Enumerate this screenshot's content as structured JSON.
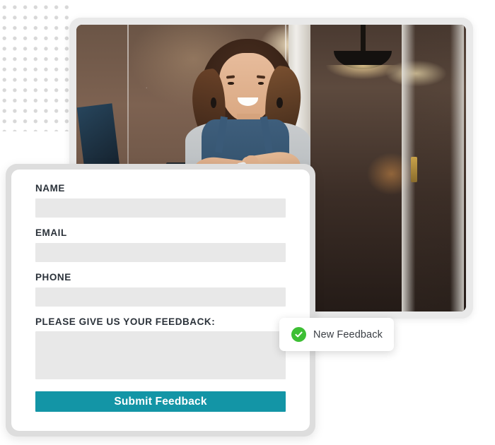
{
  "decor": {
    "dot_grid_name": "dot-grid-pattern",
    "dot_color": "#d8d8d8"
  },
  "photo_card": {
    "alt": "Smiling small business owner in a blue denim apron standing with arms crossed in her shop doorway",
    "frame_color": "#e9e9e9"
  },
  "form": {
    "fields": [
      {
        "label": "NAME",
        "value": "",
        "placeholder": "",
        "type": "text",
        "name": "name"
      },
      {
        "label": "EMAIL",
        "value": "",
        "placeholder": "",
        "type": "text",
        "name": "email"
      },
      {
        "label": "PHONE",
        "value": "",
        "placeholder": "",
        "type": "text",
        "name": "phone"
      }
    ],
    "feedback": {
      "label": "PLEASE GIVE US YOUR FEEDBACK:",
      "value": "",
      "placeholder": ""
    },
    "submit_label": "Submit Feedback",
    "accent_color": "#1395a6",
    "label_color": "#2b323a",
    "input_bg": "#e8e8e8"
  },
  "toast": {
    "icon": "check-circle-icon",
    "text": "New Feedback",
    "icon_color": "#3dbf34",
    "text_color": "#3b3f45"
  }
}
